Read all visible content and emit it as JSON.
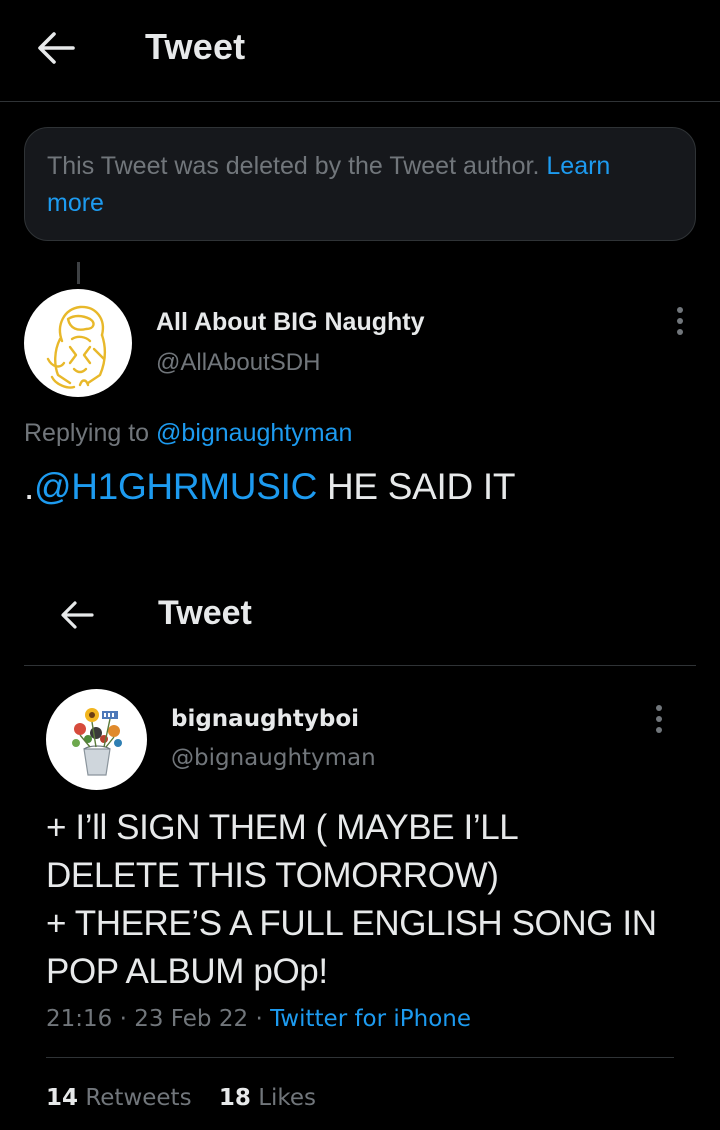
{
  "header": {
    "title": "Tweet",
    "back_icon": "arrow-left-icon"
  },
  "notice": {
    "text": "This Tweet was deleted by the Tweet author.",
    "link": "Learn more"
  },
  "tweet": {
    "author_name": "All About BIG Naughty",
    "author_handle": "@AllAboutSDH",
    "replying_prefix": "Replying to",
    "replying_handle": "@bignaughtyman",
    "text_prefix": ".",
    "text_mention": "@H1GHRMUSIC",
    "text_rest": " HE SAID IT",
    "more_icon": "more-vertical-icon"
  },
  "embedded": {
    "title": "Tweet",
    "author_name": "bignaughtyboi",
    "author_handle": "@bignaughtyman",
    "lines": [
      "+ I’ll SIGN THEM ( MAYBE I’LL",
      "DELETE THIS TOMORROW)",
      "+ THERE’S A FULL ENGLISH SONG IN",
      "POP ALBUM pOp!"
    ],
    "time": "21:16",
    "date": "23 Feb 22",
    "source": "Twitter for iPhone",
    "separator": "·",
    "retweets_count": "14",
    "retweets_label": "Retweets",
    "likes_count": "18",
    "likes_label": "Likes"
  },
  "colors": {
    "background": "#000000",
    "accent": "#1d9bf0",
    "secondary_text": "#71767b",
    "primary_text": "#e7e9ea"
  }
}
